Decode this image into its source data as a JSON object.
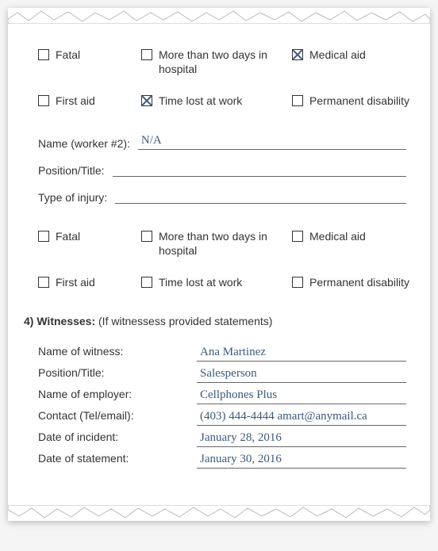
{
  "worker1_checks": {
    "row1": [
      {
        "label": "Fatal",
        "checked": false
      },
      {
        "label": "More than two days in hospital",
        "checked": false
      },
      {
        "label": "Medical aid",
        "checked": true
      }
    ],
    "row2": [
      {
        "label": "First aid",
        "checked": false
      },
      {
        "label": "Time lost at work",
        "checked": true
      },
      {
        "label": "Permanent disability",
        "checked": false
      }
    ]
  },
  "worker2_fields": {
    "name_label": "Name (worker #2):",
    "name_value": "N/A",
    "position_label": "Position/Title:",
    "position_value": "",
    "injury_label": "Type of injury:",
    "injury_value": ""
  },
  "worker2_checks": {
    "row1": [
      {
        "label": "Fatal",
        "checked": false
      },
      {
        "label": "More than two days in hospital",
        "checked": false
      },
      {
        "label": "Medical aid",
        "checked": false
      }
    ],
    "row2": [
      {
        "label": "First aid",
        "checked": false
      },
      {
        "label": "Time lost at work",
        "checked": false
      },
      {
        "label": "Permanent disability",
        "checked": false
      }
    ]
  },
  "section4": {
    "heading_num": "4) Witnesses:",
    "heading_desc": " (If witnessess provided statements)"
  },
  "witness": {
    "name_label": "Name of witness:",
    "name_value": "Ana Martinez",
    "position_label": "Position/Title:",
    "position_value": "Salesperson",
    "employer_label": "Name of employer:",
    "employer_value": "Cellphones Plus",
    "contact_label": "Contact (Tel/email):",
    "contact_value": "(403) 444-4444   amart@anymail.ca",
    "incident_label": "Date of incident:",
    "incident_value": "January 28, 2016",
    "statement_label": "Date of statement:",
    "statement_value": "January 30, 2016"
  }
}
